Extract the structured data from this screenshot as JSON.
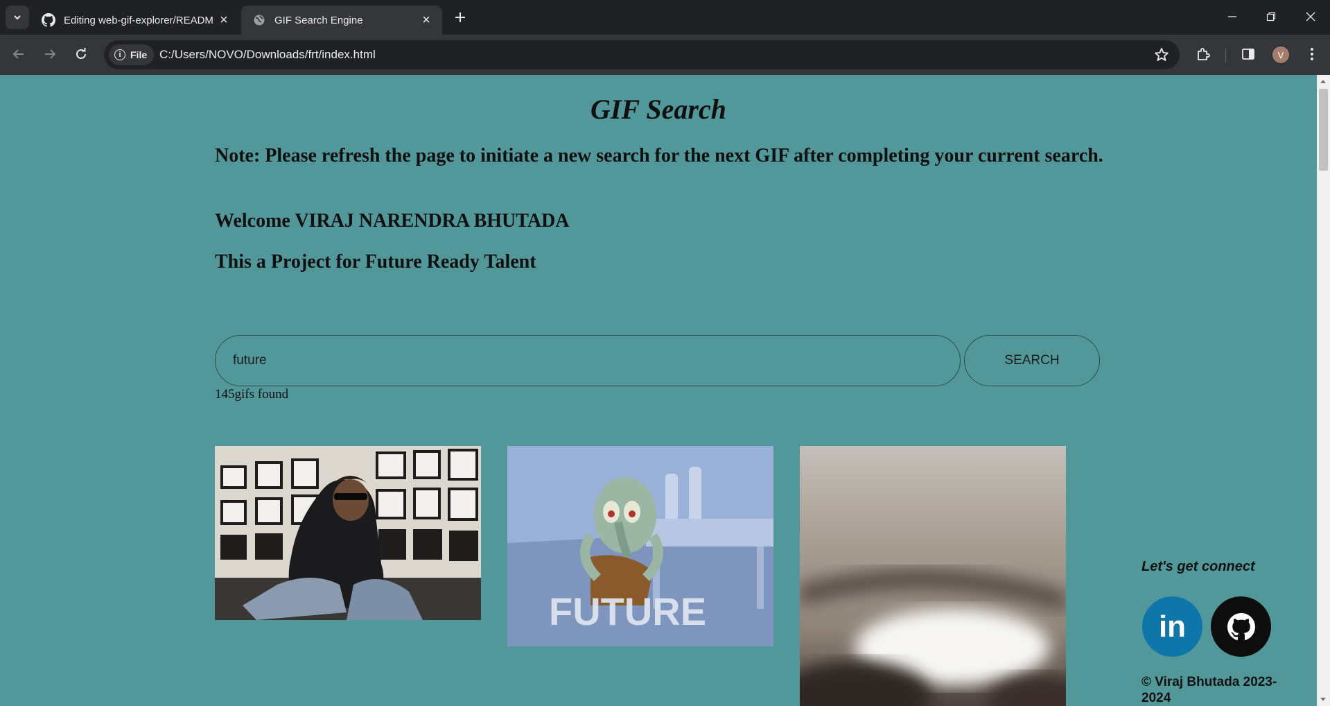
{
  "browser": {
    "tabs": [
      {
        "title": "Editing web-gif-explorer/READM",
        "icon": "github-icon"
      },
      {
        "title": "GIF Search Engine",
        "icon": "globe-icon"
      }
    ],
    "address_chip": "File",
    "url": "C:/Users/NOVO/Downloads/frt/index.html",
    "profile_initial": "V"
  },
  "page": {
    "title": "GIF Search",
    "note": "Note: Please refresh the page to initiate a new search for the next GIF after completing your current search.",
    "welcome": "Welcome VIRAJ NARENDRA BHUTADA",
    "project": "This a Project for Future Ready Talent",
    "search": {
      "value": "future",
      "button_label": "SEARCH"
    },
    "result_count": "145gifs found",
    "gifs": [
      {
        "description": "man in sunglasses sitting against photo wall"
      },
      {
        "description": "Squidward on the phone cartoon",
        "caption": "FUTURE"
      },
      {
        "description": "blurry close-up image"
      }
    ],
    "footer": {
      "connect": "Let's get connect",
      "linkedin_label": "in",
      "copyright": "© Viraj Bhutada 2023-2024"
    }
  },
  "colors": {
    "page_background": "#52989b",
    "linkedin": "#0e76a8",
    "github": "#0d0d0d"
  }
}
